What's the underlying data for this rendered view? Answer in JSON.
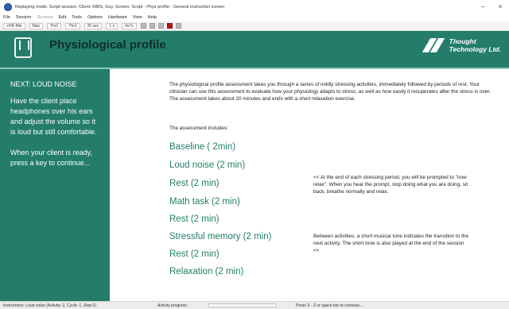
{
  "window": {
    "title": "Replaying mode. Script session. Client: MMS, Guy. Screen: Script - Phys profile - General instruction screen",
    "controls": {
      "minimize": "–",
      "close": "×"
    }
  },
  "menu": [
    "File",
    "Session",
    "Screens",
    "Edit",
    "Tools",
    "Options",
    "Hardware",
    "View",
    "Help"
  ],
  "toolbar": {
    "fields": [
      "+HR  Min",
      "Max",
      "Thr1",
      "Thr2",
      "20 sec",
      "1 s",
      "0s7s"
    ]
  },
  "header": {
    "title": "Physiological profile",
    "logo_line1": "Thought",
    "logo_line2": "Technology Ltd."
  },
  "sidebar": {
    "heading": "NEXT: LOUD NOISE",
    "paragraph1": "Have the client place headphones over his ears and adjust the volume so it is loud but still comfortable.",
    "paragraph2": "When your client is ready, press a key to continue..."
  },
  "main": {
    "intro": "The physiological profile assessment takes you through a series of mildly stressing activities, immediately followed by periods of rest. Your clinician can use this assessment to evaluate how your physiology adapts to stress, as well as how easily it recuperates after the stress is over. The assessment takes about 20 minutes and ends with a short relaxation exercise.",
    "includes_label": "The assessment includes:",
    "activities": [
      "Baseline ( 2min)",
      "Loud noise (2 min)",
      "Rest (2 min)",
      "Math task (2 min)",
      "Rest (2 min)",
      "Stressful memory (2 min)",
      "Rest (2 min)",
      "Relaxation (2 min)"
    ],
    "note1": "<< At the end of each stressing period, you will be prompted to \"now relax\". When you hear the prompt, stop doing what you are doing, sit back, breathe normally and relax.",
    "note2": "Between activities, a short musical tone indicates the transition to the next activity. The short tone is also played at the end of the session",
    "note2_tail": "<<"
  },
  "status": {
    "instructions": "Instructions: Loud noise (Activity: 2, Cycle: 1, Step:2)",
    "activity_progress_label": "Activity progress:",
    "activity_progress": 0,
    "hint": "Press X - Z or space bar to continue..."
  },
  "colors": {
    "accent_green": "#237d6a",
    "stripe": "#8fc9b8"
  }
}
